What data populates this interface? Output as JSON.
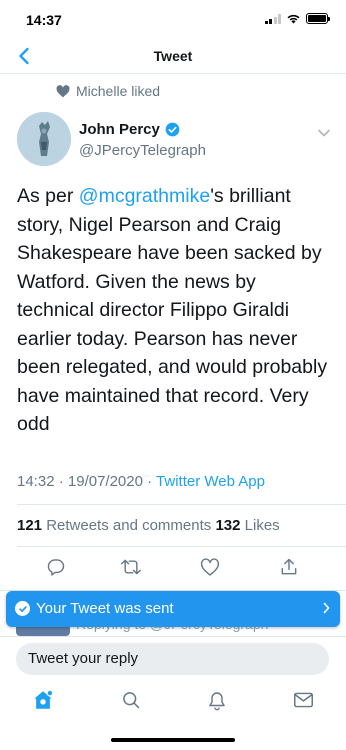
{
  "status_bar": {
    "time": "14:37"
  },
  "nav": {
    "title": "Tweet"
  },
  "social_context": {
    "text": "Michelle liked"
  },
  "author": {
    "name": "John Percy",
    "handle": "@JPercyTelegraph"
  },
  "tweet": {
    "mention": "@mcgrathmike",
    "text_before": "As per ",
    "text_after": "'s brilliant story, Nigel Pearson and Craig Shakespeare have been sacked by Watford. Given the news by technical director Filippo Giraldi earlier today. Pearson has never been relegated, and would probably have maintained that record. Very odd"
  },
  "meta": {
    "time": "14:32",
    "date": "19/07/2020",
    "separator": " · ",
    "source": "Twitter Web App"
  },
  "stats": {
    "retweets_count": "121",
    "retweets_label": " Retweets and comments  ",
    "likes_count": "132",
    "likes_label": " Likes"
  },
  "hidden_reply": {
    "text": "Replying to @JPercyTelegraph"
  },
  "toast": {
    "text": "Your Tweet was sent"
  },
  "reply": {
    "placeholder": "Tweet your reply"
  },
  "colors": {
    "accent": "#1da1f2",
    "toast": "#2295ee",
    "secondary_text": "#657786"
  },
  "icons": {
    "actions": [
      "comment-icon",
      "retweet-icon",
      "like-icon",
      "share-icon"
    ],
    "tabs": [
      "home-icon",
      "search-icon",
      "notifications-icon",
      "messages-icon"
    ]
  }
}
